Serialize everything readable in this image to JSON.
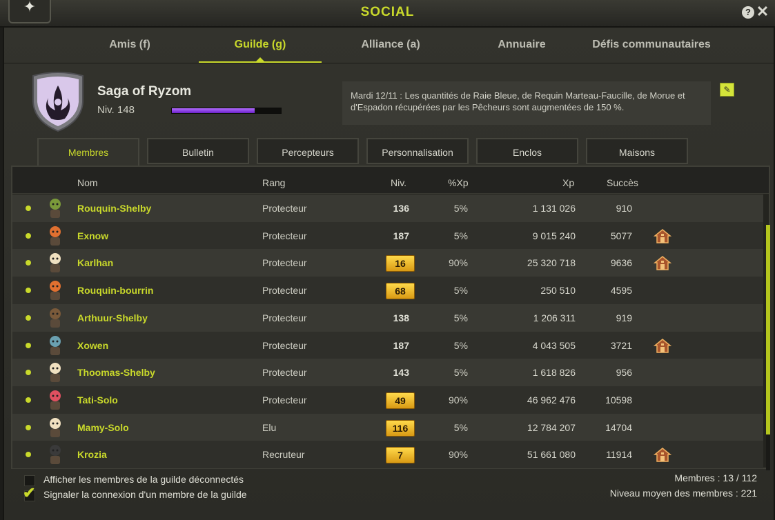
{
  "window": {
    "title": "SOCIAL"
  },
  "main_tabs": [
    {
      "label": "Amis (f)"
    },
    {
      "label": "Guilde (g)"
    },
    {
      "label": "Alliance (a)"
    },
    {
      "label": "Annuaire"
    },
    {
      "label": "Défis communautaires"
    }
  ],
  "guild": {
    "name": "Saga of Ryzom",
    "level": "Niv. 148",
    "xp_progress": 0.76,
    "news": "Mardi 12/11 : Les quantités de Raie Bleue, de Requin Marteau-Faucille, de Morue et d'Espadon récupérées par les Pêcheurs sont augmentées de 150 %."
  },
  "sub_tabs": [
    {
      "label": "Membres"
    },
    {
      "label": "Bulletin"
    },
    {
      "label": "Percepteurs"
    },
    {
      "label": "Personnalisation"
    },
    {
      "label": "Enclos"
    },
    {
      "label": "Maisons"
    }
  ],
  "table": {
    "headers": {
      "name": "Nom",
      "rank": "Rang",
      "level": "Niv.",
      "pct_xp": "%Xp",
      "xp": "Xp",
      "success": "Succès"
    },
    "rows": [
      {
        "name": "Rouquin-Shelby",
        "rank": "Protecteur",
        "level": "136",
        "badge": false,
        "pct_xp": "5%",
        "xp": "1 131 026",
        "success": "910",
        "house": false
      },
      {
        "name": "Exnow",
        "rank": "Protecteur",
        "level": "187",
        "badge": false,
        "pct_xp": "5%",
        "xp": "9 015 240",
        "success": "5077",
        "house": true
      },
      {
        "name": "Karlhan",
        "rank": "Protecteur",
        "level": "16",
        "badge": true,
        "pct_xp": "90%",
        "xp": "25 320 718",
        "success": "9636",
        "house": true
      },
      {
        "name": "Rouquin-bourrin",
        "rank": "Protecteur",
        "level": "68",
        "badge": true,
        "pct_xp": "5%",
        "xp": "250 510",
        "success": "4595",
        "house": false
      },
      {
        "name": "Arthuur-Shelby",
        "rank": "Protecteur",
        "level": "138",
        "badge": false,
        "pct_xp": "5%",
        "xp": "1 206 311",
        "success": "919",
        "house": false
      },
      {
        "name": "Xowen",
        "rank": "Protecteur",
        "level": "187",
        "badge": false,
        "pct_xp": "5%",
        "xp": "4 043 505",
        "success": "3721",
        "house": true
      },
      {
        "name": "Thoomas-Shelby",
        "rank": "Protecteur",
        "level": "143",
        "badge": false,
        "pct_xp": "5%",
        "xp": "1 618 826",
        "success": "956",
        "house": false
      },
      {
        "name": "Tati-Solo",
        "rank": "Protecteur",
        "level": "49",
        "badge": true,
        "pct_xp": "90%",
        "xp": "46 962 476",
        "success": "10598",
        "house": false
      },
      {
        "name": "Mamy-Solo",
        "rank": "Elu",
        "level": "116",
        "badge": true,
        "pct_xp": "5%",
        "xp": "12 784 207",
        "success": "14704",
        "house": false
      },
      {
        "name": "Krozia",
        "rank": "Recruteur",
        "level": "7",
        "badge": true,
        "pct_xp": "90%",
        "xp": "51 661 080",
        "success": "11914",
        "house": true
      }
    ]
  },
  "footer": {
    "show_offline_label": "Afficher les membres de la guilde déconnectés",
    "notify_label": "Signaler la connexion d'un membre de la guilde",
    "members_count": "Membres : 13 / 112",
    "avg_level": "Niveau moyen des membres : 221"
  },
  "colors": {
    "accent": "#c9d92b",
    "xp_bar": "#8a3cff",
    "badge": "#f2b625"
  }
}
